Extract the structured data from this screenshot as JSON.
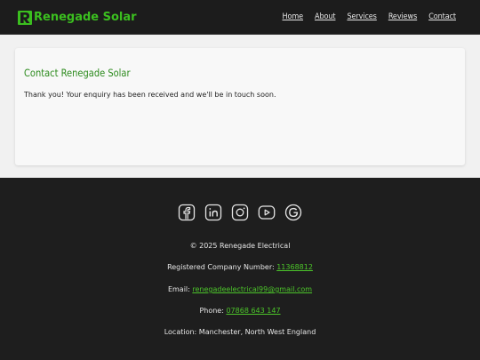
{
  "header": {
    "brand": "Renegade Solar",
    "nav": [
      {
        "label": "Home"
      },
      {
        "label": "About"
      },
      {
        "label": "Services"
      },
      {
        "label": "Reviews"
      },
      {
        "label": "Contact"
      }
    ]
  },
  "main": {
    "title": "Contact Renegade Solar",
    "message": "Thank you! Your enquiry has been received and we'll be in touch soon."
  },
  "footer": {
    "socials": [
      {
        "icon": "facebook-icon"
      },
      {
        "icon": "linkedin-icon"
      },
      {
        "icon": "instagram-icon"
      },
      {
        "icon": "youtube-icon"
      },
      {
        "icon": "google-icon"
      }
    ],
    "copyright": "© 2025 Renegade Electrical",
    "company_label": "Registered Company Number:",
    "company_number": "11368812",
    "email_label": "Email:",
    "email": "renegadeelectrical99@gmail.com",
    "phone_label": "Phone:",
    "phone": "07868 643 147",
    "location": "Location: Manchester, North West England"
  },
  "colors": {
    "brand_green": "#3bbf1f",
    "title_green": "#2b8a1c",
    "link_green": "#4cc52a",
    "header_bg": "#1c1c1c",
    "footer_bg": "#1e1e1e"
  }
}
